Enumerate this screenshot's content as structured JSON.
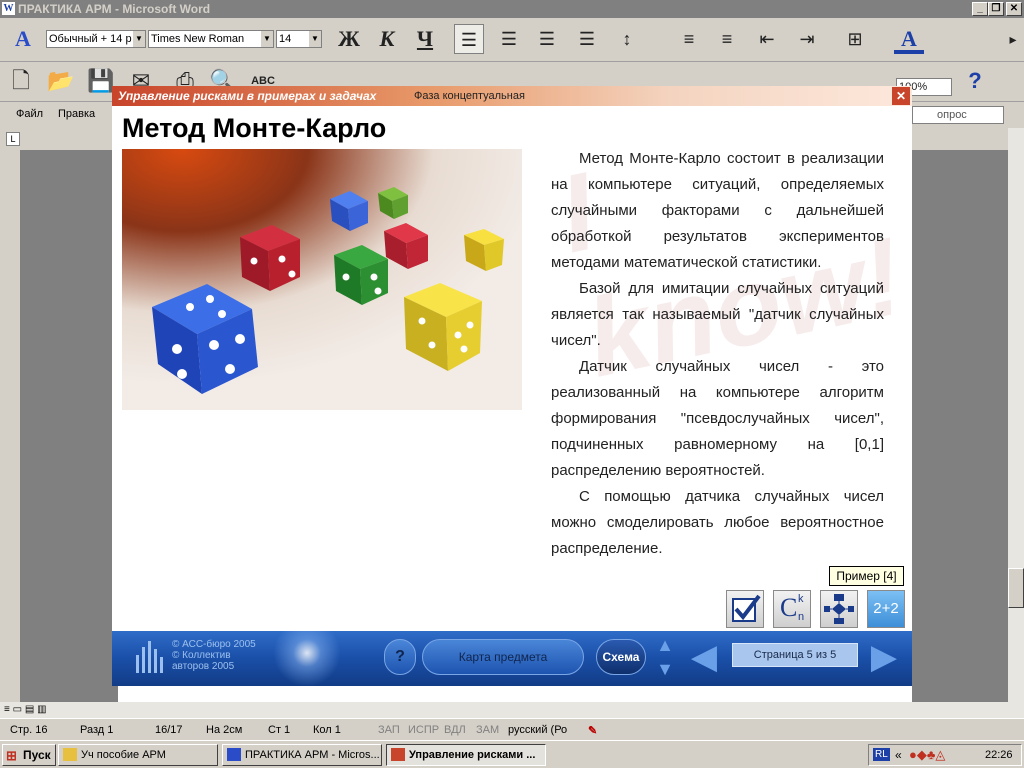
{
  "word": {
    "title": "ПРАКТИКА АРМ - Microsoft Word",
    "style_combo": "Обычный + 14 р",
    "font_combo": "Times New Roman",
    "size_combo": "14",
    "zoom": "100%",
    "help_box_placeholder": "опрос",
    "menu": [
      "Файл",
      "Правка"
    ]
  },
  "app": {
    "header_title": "Управление рисками в примерах и задачах",
    "header_subtitle": "Фаза концептуальная",
    "title": "Метод Монте-Карло",
    "paragraphs": [
      "Метод Монте-Карло состоит в реализации на компьютере ситуаций, определяемых случайными факторами с дальнейшей обработкой результатов экспериментов методами математической статистики.",
      "Базой для имитации случайных ситуаций является так называемый \"датчик случайных чисел\".",
      "Датчик случайных чисел - это реализованный на компьютере алгоритм формирования \"псевдослучайных чисел\", подчиненных равномерному на [0,1] распределению вероятностей.",
      "С помощью датчика случайных чисел можно смоделировать любое вероятностное распределение."
    ],
    "tooltip": "Пример [4]",
    "buttons": {
      "combinatorics": "C",
      "combinatorics_sup": "k",
      "combinatorics_sub": "n",
      "example": "2+2"
    },
    "nav": {
      "copyright_lines": [
        "© АСС-бюро 2005",
        "© Коллектив",
        "авторов 2005"
      ],
      "help": "?",
      "map": "Карта предмета",
      "scheme": "Схема",
      "page_label": "Страница 5 из 5"
    }
  },
  "status": {
    "page": "Стр. 16",
    "section": "Разд 1",
    "pages": "16/17",
    "at": "На 2см",
    "line": "Ст 1",
    "col": "Кол 1",
    "rec": "ЗАП",
    "trk": "ИСПР",
    "ext": "ВДЛ",
    "ovr": "ЗАМ",
    "lang": "русский (Ро"
  },
  "taskbar": {
    "start": "Пуск",
    "tasks": [
      "Уч пособие АРМ",
      "ПРАКТИКА АРМ - Micros...",
      "Управление рисками ..."
    ],
    "lang": "RL",
    "clock": "22:26"
  },
  "colors": {
    "nav_blue": "#1a4fa8",
    "header_red": "#c8442a",
    "example_blue": "#4a9de0"
  }
}
